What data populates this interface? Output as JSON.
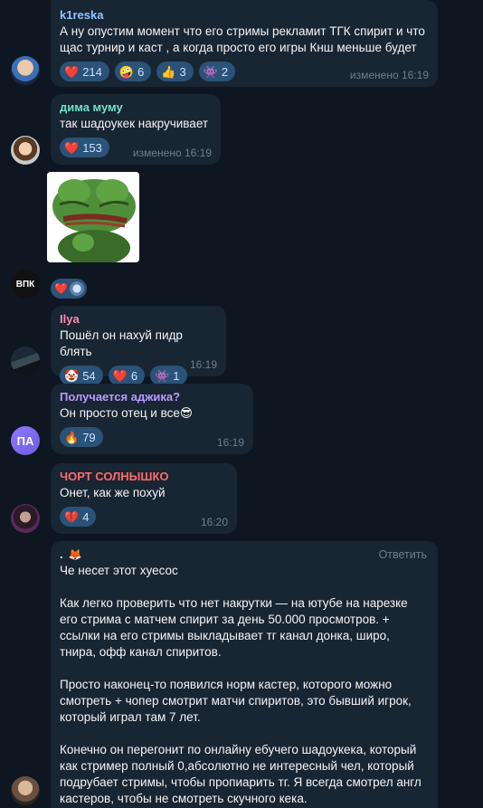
{
  "messages": [
    {
      "author": "k1reska",
      "author_color": "#8ec6ff",
      "text": "А ну опустим момент что его стримы рекламит ТГК спирит и что щас турнир и каст , а когда просто его игры Кнш меньше будет",
      "reactions": [
        {
          "emoji": "❤️",
          "count": "214"
        },
        {
          "emoji": "🤪",
          "count": "6"
        },
        {
          "emoji": "👍",
          "count": "3"
        },
        {
          "emoji": "👾",
          "count": "2"
        }
      ],
      "time": "изменено 16:19"
    },
    {
      "author": "дима муму",
      "author_color": "#6ee3c8",
      "text": "так шадоукек накручивает",
      "reactions": [
        {
          "emoji": "❤️",
          "count": "153"
        }
      ],
      "time": "изменено 16:19"
    },
    {
      "sender_avatar_text": "ВПК",
      "sticker": "pepe-sticker",
      "reactions_mini": [
        "❤️",
        "avatar"
      ]
    },
    {
      "author": "Ilya",
      "author_color": "#ff8aa9",
      "text": "Пошёл он нахуй пидр блять",
      "reactions": [
        {
          "emoji": "🤡",
          "count": "54"
        },
        {
          "emoji": "❤️",
          "count": "6"
        },
        {
          "emoji": "👾",
          "count": "1"
        }
      ],
      "time": "16:19"
    },
    {
      "author": "Получается аджика?",
      "author_color": "#b99aff",
      "text": "Он просто отец и все😎",
      "avatar_text": "ПА",
      "reactions": [
        {
          "emoji": "🔥",
          "count": "79"
        }
      ],
      "time": "16:19"
    },
    {
      "author": "ЧОРТ СОЛНЫШКО",
      "author_color": "#ff6b6b",
      "text": "Онет, как же похуй",
      "reactions": [
        {
          "emoji": "💔",
          "count": "4"
        }
      ],
      "time": "16:20"
    },
    {
      "author": ".",
      "author_color": "#f5f5f5",
      "reply_label": "Ответить",
      "paragraphs": [
        "Че несет этот хуесос",
        "Как легко проверить что нет накрутки — на ютубе на нарезке его стрима с матчем спирит за день 50.000 просмотров. + ссылки на его стримы выкладывает тг канал донка, широ, тнира, офф канал спиритов.",
        "Просто наконец-то появился норм кастер, которого можно смотреть + чопер смотрит матчи спиритов, это бывший игрок, который играл там 7 лет.",
        "Конечно он перегонит по онлайну ебучего шадоукека, который как стример полный 0,абсолютно не интересный чел, который подрубает стримы, чтобы пропиарить тг. Я всегда смотрел англ кастеров, чтобы не смотреть скучного кека."
      ]
    }
  ]
}
